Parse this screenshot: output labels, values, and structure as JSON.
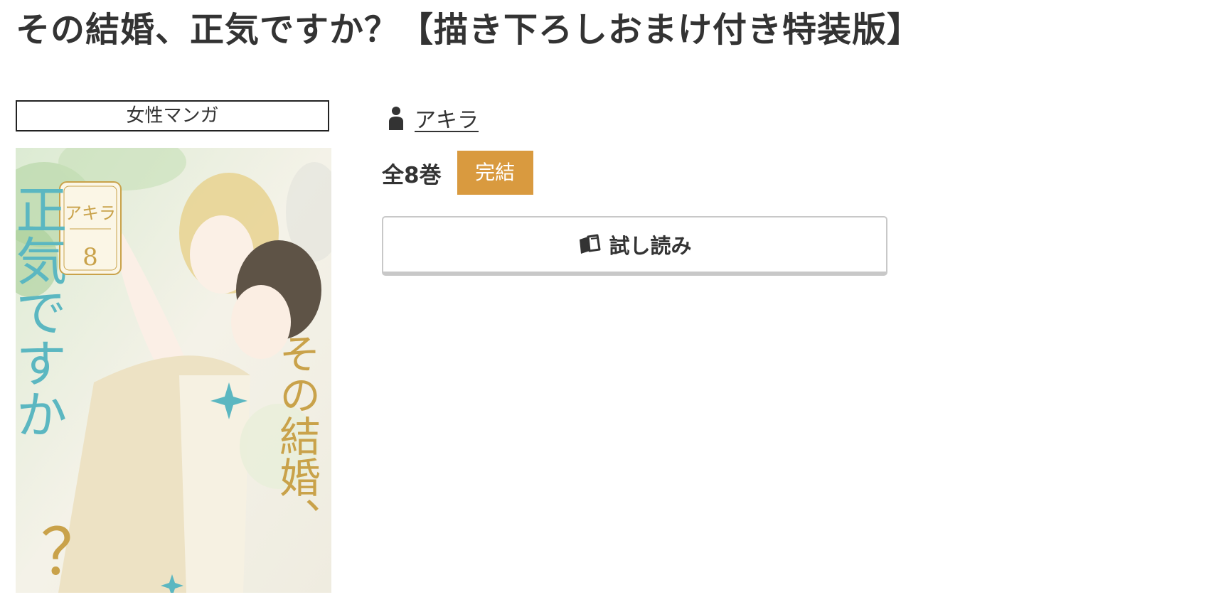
{
  "title": "その結婚、正気ですか？【描き下ろしおまけ付き特装版】",
  "genre": "女性マンガ",
  "author": {
    "icon": "person-icon",
    "name": "アキラ"
  },
  "volumes": {
    "count_label": "全8巻",
    "status_label": "完結",
    "status_color": "#d99a3f"
  },
  "trial": {
    "icon": "open-book-icon",
    "label": "試し読み"
  },
  "cover": {
    "author": "アキラ",
    "volume_number": "8",
    "title_main": "その結婚、",
    "title_teal": "正気ですか",
    "question_mark": "？",
    "accent_teal": "#5bb7c1",
    "accent_gold": "#c9a24a"
  }
}
